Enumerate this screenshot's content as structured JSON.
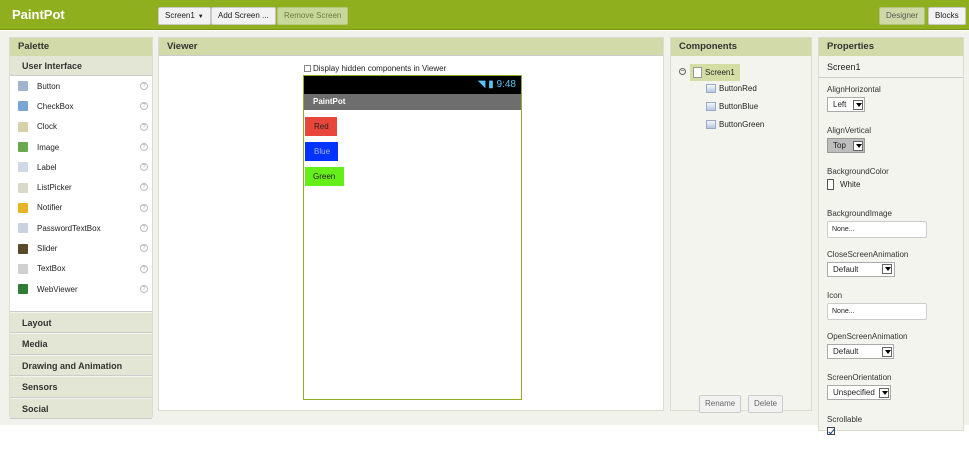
{
  "app": {
    "title": "PaintPot"
  },
  "toolbar": {
    "screen_select": "Screen1",
    "add_screen": "Add Screen ...",
    "remove_screen": "Remove Screen",
    "designer": "Designer",
    "blocks": "Blocks"
  },
  "palette": {
    "title": "Palette",
    "section": "User Interface",
    "items": [
      {
        "label": "Button",
        "icon": "button-icon",
        "color": "#9fb3cc"
      },
      {
        "label": "CheckBox",
        "icon": "checkbox-icon",
        "color": "#7aa6d6"
      },
      {
        "label": "Clock",
        "icon": "clock-icon",
        "color": "#d6d1a9"
      },
      {
        "label": "Image",
        "icon": "image-icon",
        "color": "#6aa84f"
      },
      {
        "label": "Label",
        "icon": "label-icon",
        "color": "#cfd8e6"
      },
      {
        "label": "ListPicker",
        "icon": "listpicker-icon",
        "color": "#d9d9c9"
      },
      {
        "label": "Notifier",
        "icon": "notifier-icon",
        "color": "#e6b422"
      },
      {
        "label": "PasswordTextBox",
        "icon": "password-textbox-icon",
        "color": "#c9d3e0"
      },
      {
        "label": "Slider",
        "icon": "slider-icon",
        "color": "#5a4a2a"
      },
      {
        "label": "TextBox",
        "icon": "textbox-icon",
        "color": "#d0d0d0"
      },
      {
        "label": "WebViewer",
        "icon": "webviewer-icon",
        "color": "#2e7d32"
      }
    ],
    "categories": [
      "Layout",
      "Media",
      "Drawing and Animation",
      "Sensors",
      "Social"
    ]
  },
  "viewer": {
    "title": "Viewer",
    "hidden_label": "Display hidden components in Viewer",
    "status_time": "9:48",
    "screen_title": "PaintPot",
    "buttons": [
      {
        "label": "Red",
        "color": "#e8463b",
        "text_color": "#222"
      },
      {
        "label": "Blue",
        "color": "#0033ff",
        "text_color": "#aab6e6"
      },
      {
        "label": "Green",
        "color": "#66ee1a",
        "text_color": "#222"
      }
    ]
  },
  "components": {
    "title": "Components",
    "root": "Screen1",
    "children": [
      "ButtonRed",
      "ButtonBlue",
      "ButtonGreen"
    ],
    "rename": "Rename",
    "delete": "Delete"
  },
  "properties": {
    "title": "Properties",
    "component": "Screen1",
    "align_horizontal": {
      "label": "AlignHorizontal",
      "value": "Left"
    },
    "align_vertical": {
      "label": "AlignVertical",
      "value": "Top"
    },
    "background_color": {
      "label": "BackgroundColor",
      "value": "White"
    },
    "background_image": {
      "label": "BackgroundImage",
      "value": "None..."
    },
    "close_animation": {
      "label": "CloseScreenAnimation",
      "value": "Default"
    },
    "icon": {
      "label": "Icon",
      "value": "None..."
    },
    "open_animation": {
      "label": "OpenScreenAnimation",
      "value": "Default"
    },
    "orientation": {
      "label": "ScreenOrientation",
      "value": "Unspecified"
    },
    "scrollable": {
      "label": "Scrollable",
      "checked": true
    }
  }
}
